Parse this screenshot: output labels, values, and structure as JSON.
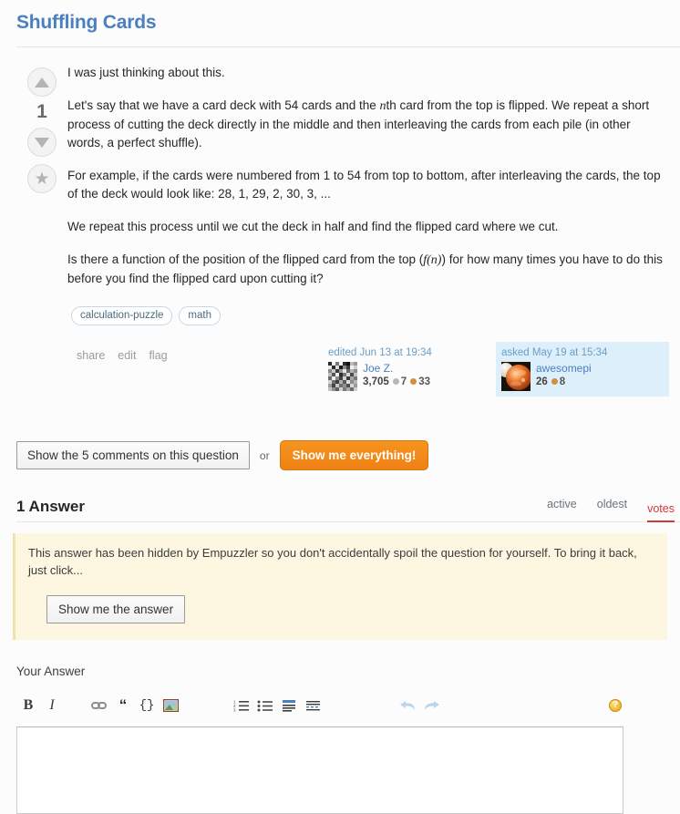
{
  "page_title": "Shuffling Cards",
  "question": {
    "vote_count": "1",
    "upvote_icon": "arrow-up-icon",
    "downvote_icon": "arrow-down-icon",
    "favorite_icon": "star-icon",
    "paragraphs": [
      "I was just thinking about this.",
      "Let's say that we have a card deck with 54 cards and the nth card from the top is flipped. We repeat a short process of cutting the deck directly in the middle and then interleaving the cards from each pile (in other words, a perfect shuffle).",
      "For example, if the cards were numbered from 1 to 54 from top to bottom, after interleaving the cards, the top of the deck would look like: 28, 1, 29, 2, 30, 3, ...",
      "We repeat this process until we cut the deck in half and find the flipped card where we cut.",
      "Is there a function of the position of the flipped card from the top (f(n)) for how many times you have to do this before you find the flipped card upon cutting it?"
    ],
    "p2_pre": "Let's say that we have a card deck with 54 cards and the ",
    "p2_math": "n",
    "p2_post": "th card from the top is flipped. We repeat a short process of cutting the deck directly in the middle and then interleaving the cards from each pile (in other words, a perfect shuffle).",
    "p5_pre": "Is there a function of the position of the flipped card from the top (",
    "p5_math_f": "f",
    "p5_math_paren_open": "(",
    "p5_math_n": "n",
    "p5_math_paren_close": ")",
    "p5_post": ") for how many times you have to do this before you find the flipped card upon cutting it?",
    "tags": [
      "calculation-puzzle",
      "math"
    ],
    "actions": [
      "share",
      "edit",
      "flag"
    ],
    "editor_card": {
      "action_text": "edited Jun 13 at 19:34",
      "user_name": "Joe Z.",
      "reputation": "3,705",
      "silver_badges": "7",
      "bronze_badges": "33",
      "avatar_name": "avatar-joe-z"
    },
    "asker_card": {
      "action_text": "asked May 19 at 15:34",
      "user_name": "awesomepi",
      "reputation": "26",
      "bronze_badges": "8",
      "avatar_name": "avatar-awesomepi"
    }
  },
  "comments_bar": {
    "show_comments_label": "Show the 5 comments on this question",
    "or_label": "or",
    "show_everything_label": "Show me everything!"
  },
  "answers": {
    "count_label": "1 Answer",
    "tabs": [
      {
        "label": "active",
        "active": false
      },
      {
        "label": "oldest",
        "active": false
      },
      {
        "label": "votes",
        "active": true
      }
    ],
    "hidden_notice": {
      "text": "This answer has been hidden by Empuzzler so you don't accidentally spoil the question for yourself. To bring it back, just click...",
      "button_label": "Show me the answer"
    }
  },
  "your_answer": {
    "label": "Your Answer",
    "textarea_value": "",
    "toolbar": [
      {
        "name": "bold-icon",
        "glyph": "B"
      },
      {
        "name": "italic-icon",
        "glyph": "I"
      },
      {
        "name": "link-icon",
        "glyph": ""
      },
      {
        "name": "blockquote-icon",
        "glyph": "“"
      },
      {
        "name": "code-icon",
        "glyph": "{}"
      },
      {
        "name": "image-icon",
        "glyph": ""
      },
      {
        "name": "numbered-list-icon",
        "glyph": ""
      },
      {
        "name": "bulleted-list-icon",
        "glyph": ""
      },
      {
        "name": "heading-icon",
        "glyph": ""
      },
      {
        "name": "horizontal-rule-icon",
        "glyph": ""
      },
      {
        "name": "undo-icon",
        "glyph": ""
      },
      {
        "name": "redo-icon",
        "glyph": ""
      }
    ],
    "help_icon_glyph": "?"
  },
  "colors": {
    "title_blue": "#4a7fc1",
    "link_blue": "#6a9ec7",
    "orange_button": "#f7941e",
    "active_tab_red": "#d0393e",
    "highlight_bg": "#dceffa",
    "notice_bg": "#fdf7e2"
  }
}
